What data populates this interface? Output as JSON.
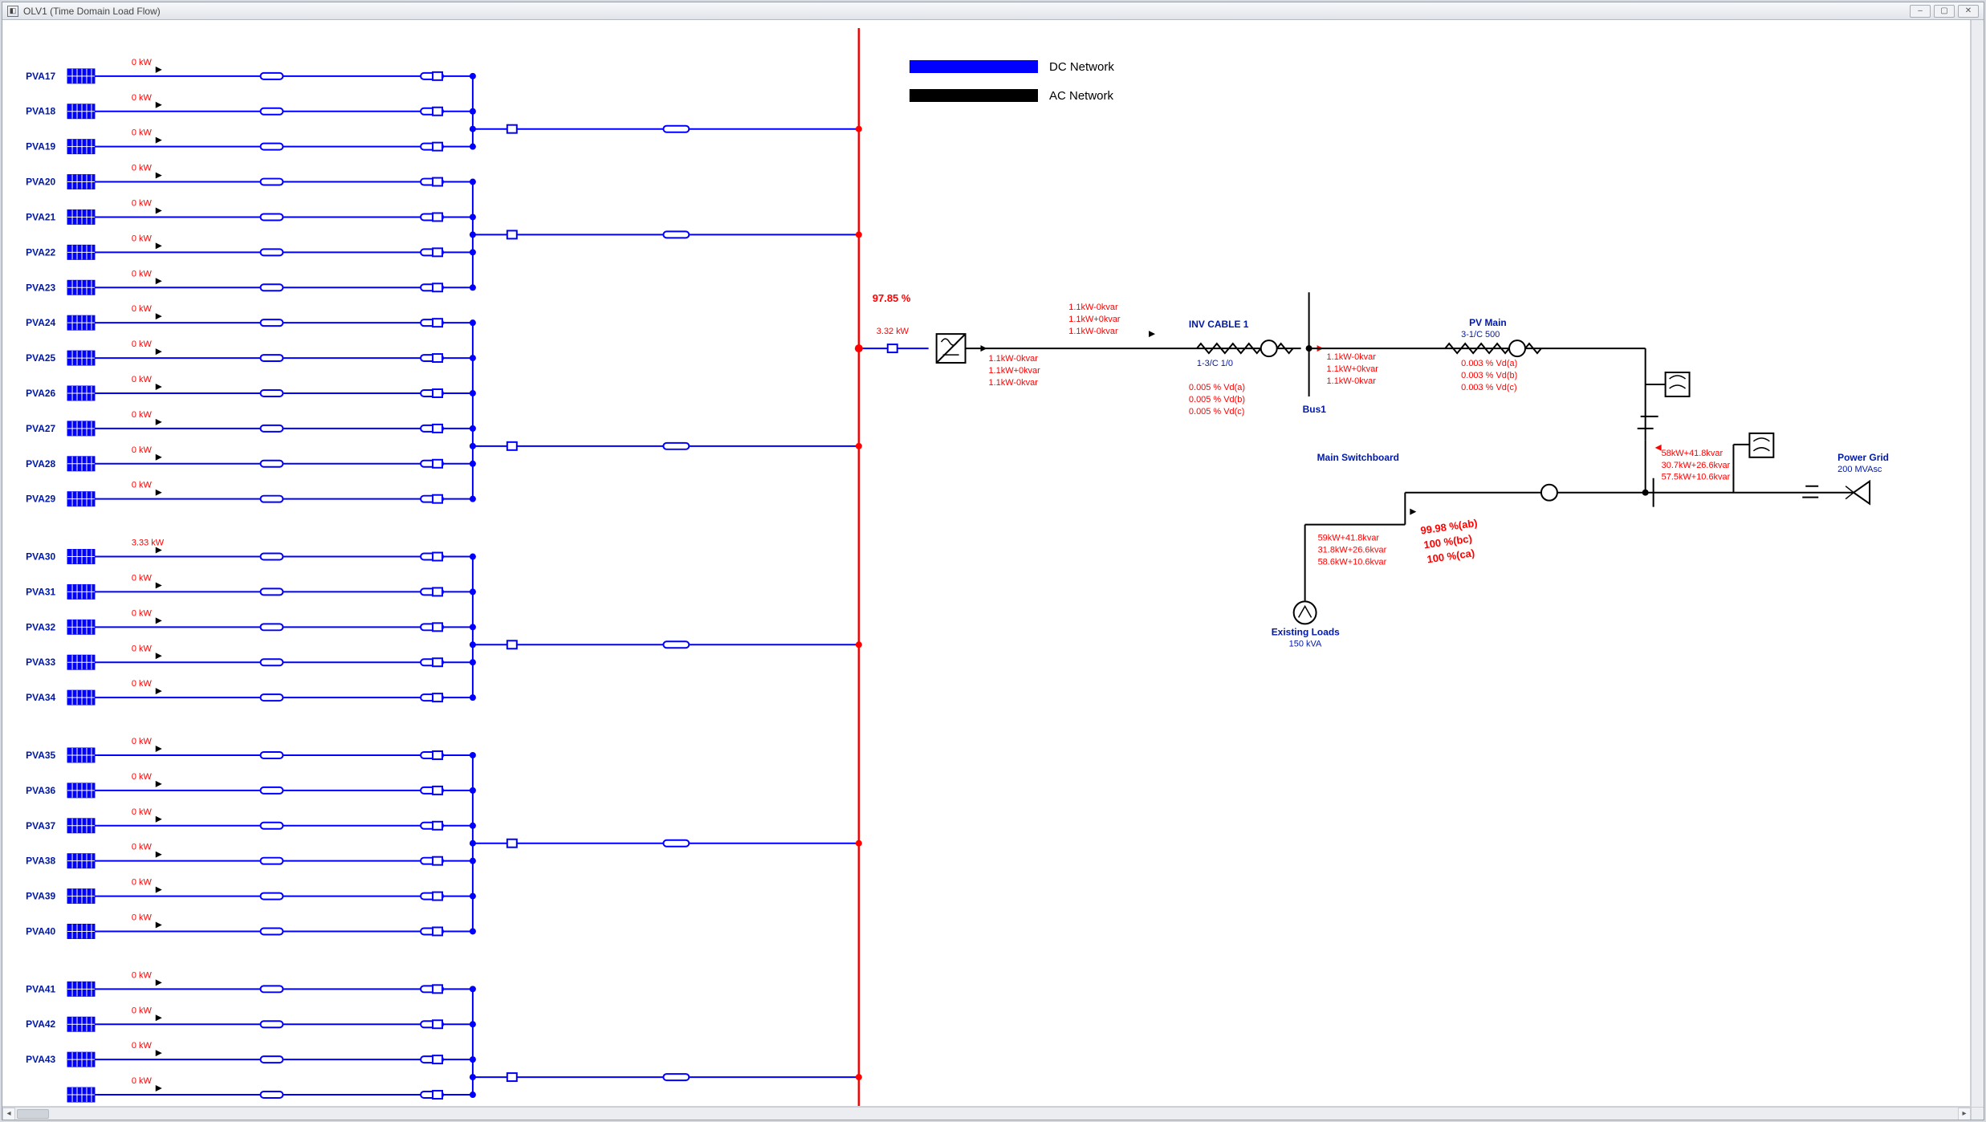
{
  "window": {
    "title": "OLV1 (Time Domain Load Flow)",
    "min": "–",
    "max": "▢",
    "close": "✕"
  },
  "legend": {
    "dc": "DC Network",
    "ac": "AC Network"
  },
  "pva": [
    {
      "id": "PVA17",
      "kw": "0 kW"
    },
    {
      "id": "PVA18",
      "kw": "0 kW"
    },
    {
      "id": "PVA19",
      "kw": "0 kW"
    },
    {
      "id": "PVA20",
      "kw": "0 kW"
    },
    {
      "id": "PVA21",
      "kw": "0 kW"
    },
    {
      "id": "PVA22",
      "kw": "0 kW"
    },
    {
      "id": "PVA23",
      "kw": "0 kW"
    },
    {
      "id": "PVA24",
      "kw": "0 kW"
    },
    {
      "id": "PVA25",
      "kw": "0 kW"
    },
    {
      "id": "PVA26",
      "kw": "0 kW"
    },
    {
      "id": "PVA27",
      "kw": "0 kW"
    },
    {
      "id": "PVA28",
      "kw": "0 kW"
    },
    {
      "id": "PVA29",
      "kw": "0 kW"
    },
    {
      "id": "PVA30",
      "kw": "3.33 kW"
    },
    {
      "id": "PVA31",
      "kw": "0 kW"
    },
    {
      "id": "PVA32",
      "kw": "0 kW"
    },
    {
      "id": "PVA33",
      "kw": "0 kW"
    },
    {
      "id": "PVA34",
      "kw": "0 kW"
    },
    {
      "id": "PVA35",
      "kw": "0 kW"
    },
    {
      "id": "PVA36",
      "kw": "0 kW"
    },
    {
      "id": "PVA37",
      "kw": "0 kW"
    },
    {
      "id": "PVA38",
      "kw": "0 kW"
    },
    {
      "id": "PVA39",
      "kw": "0 kW"
    },
    {
      "id": "PVA40",
      "kw": "0 kW"
    },
    {
      "id": "PVA41",
      "kw": "0 kW"
    },
    {
      "id": "PVA42",
      "kw": "0 kW"
    },
    {
      "id": "PVA43",
      "kw": "0 kW"
    },
    {
      "id": "",
      "kw": "0 kW"
    }
  ],
  "pva_groups": [
    {
      "start": 0,
      "end": 2,
      "collector": 70,
      "nodeCollectAt": 1
    },
    {
      "start": 3,
      "end": 6,
      "collector": 190,
      "nodeCollectAt": 4
    },
    {
      "start": 7,
      "end": 12,
      "collector": 540,
      "nodeCollectAt": 10
    },
    {
      "start": 13,
      "end": 17,
      "collector": 870,
      "nodeCollectAt": 15
    },
    {
      "start": 18,
      "end": 23,
      "collector": 1100,
      "nodeCollectAt": 20
    },
    {
      "start": 24,
      "end": 27,
      "collector": 1410,
      "nodeCollectAt": 26
    }
  ],
  "inverter": {
    "eff": "97.85 %",
    "dc_in": "3.32 kW",
    "phase_a1": [
      "1.1kW-0kvar",
      "1.1kW+0kvar",
      "1.1kW-0kvar"
    ],
    "phase_a2": [
      "1.1kW-0kvar",
      "1.1kW+0kvar",
      "1.1kW-0kvar"
    ]
  },
  "inv_cable": {
    "name": "INV CABLE 1",
    "spec": "1-3/C 1/0",
    "vd": [
      "0.005 % Vd(a)",
      "0.005 % Vd(b)",
      "0.005 % Vd(c)"
    ]
  },
  "bus1": {
    "name": "Bus1",
    "flows": [
      "1.1kW-0kvar",
      "1.1kW+0kvar",
      "1.1kW-0kvar"
    ]
  },
  "pv_main": {
    "name": "PV Main",
    "spec": "3-1/C 500",
    "vd": [
      "0.003 % Vd(a)",
      "0.003 % Vd(b)",
      "0.003 % Vd(c)"
    ]
  },
  "main_sb": {
    "name": "Main Switchboard"
  },
  "grid_in": [
    "58kW+41.8kvar",
    "30.7kW+26.6kvar",
    "57.5kW+10.6kvar"
  ],
  "grid": {
    "name": "Power Grid",
    "rating": "200 MVAsc"
  },
  "vpct": [
    "99.98 %(ab)",
    "100 %(bc)",
    "100 %(ca)"
  ],
  "loads": {
    "name": "Existing Loads",
    "rating": "150 kVA",
    "flows": [
      "59kW+41.8kvar",
      "31.8kW+26.6kvar",
      "58.6kW+10.6kvar"
    ]
  }
}
